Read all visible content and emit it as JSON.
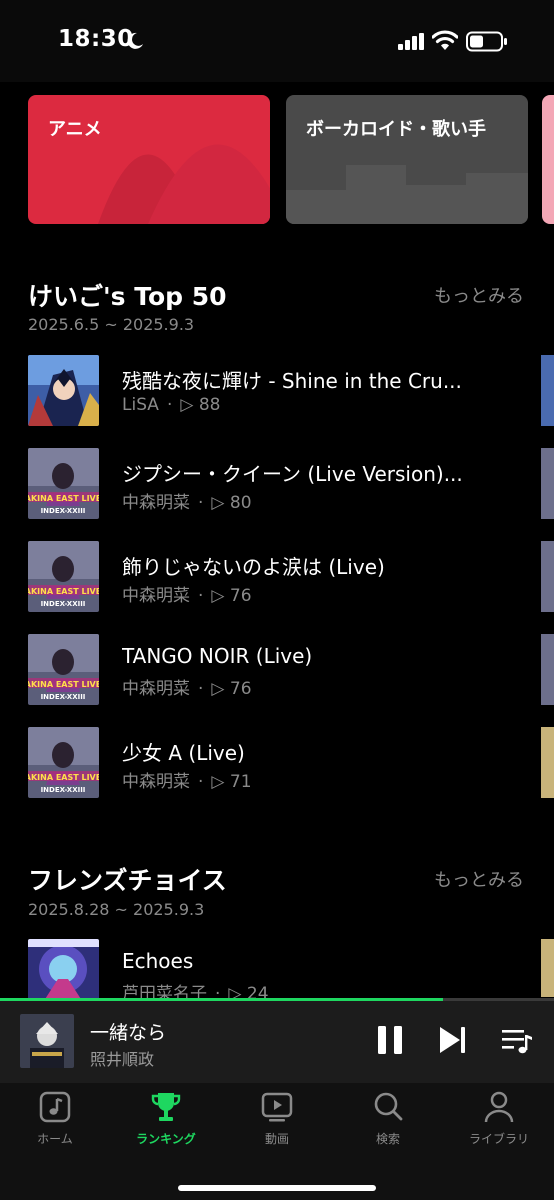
{
  "status_bar": {
    "time": "18:30"
  },
  "genres": [
    {
      "label": "アニメ",
      "color": "#dc2a40"
    },
    {
      "label": "ボーカロイド・歌い手",
      "color": "#4a4a4a"
    }
  ],
  "top50": {
    "title": "けいご's Top 50",
    "more": "もっとみる",
    "range": "2025.6.5 ~ 2025.9.3",
    "tracks": [
      {
        "title": "残酷な夜に輝け - Shine in the Cru...",
        "artist": "LiSA",
        "plays": "88"
      },
      {
        "title": "ジプシー・クイーン (Live Version)...",
        "artist": "中森明菜",
        "plays": "80"
      },
      {
        "title": "飾りじゃないのよ涙は (Live)",
        "artist": "中森明菜",
        "plays": "76"
      },
      {
        "title": "TANGO NOIR (Live)",
        "artist": "中森明菜",
        "plays": "76"
      },
      {
        "title": "少女 A (Live)",
        "artist": "中森明菜",
        "plays": "71"
      }
    ]
  },
  "friends": {
    "title": "フレンズチョイス",
    "more": "もっとみる",
    "range": "2025.8.28 ~ 2025.9.3",
    "tracks": [
      {
        "title": "Echoes",
        "artist": "芦田菜名子",
        "plays": "24"
      }
    ]
  },
  "album_text": {
    "line1": "AKINA EAST LIVE",
    "line2": "INDEX-XXIII"
  },
  "separator": "·",
  "play_glyph": "▷",
  "player": {
    "title": "一緒なら",
    "artist": "照井順政",
    "progress": 0.8
  },
  "tabs": [
    {
      "label": "ホーム",
      "icon": "music-note-icon"
    },
    {
      "label": "ランキング",
      "icon": "trophy-icon",
      "active": true
    },
    {
      "label": "動画",
      "icon": "video-play-icon"
    },
    {
      "label": "検索",
      "icon": "search-icon"
    },
    {
      "label": "ライブラリ",
      "icon": "person-icon"
    }
  ],
  "colors": {
    "accent": "#1ed760",
    "background": "#000000"
  }
}
